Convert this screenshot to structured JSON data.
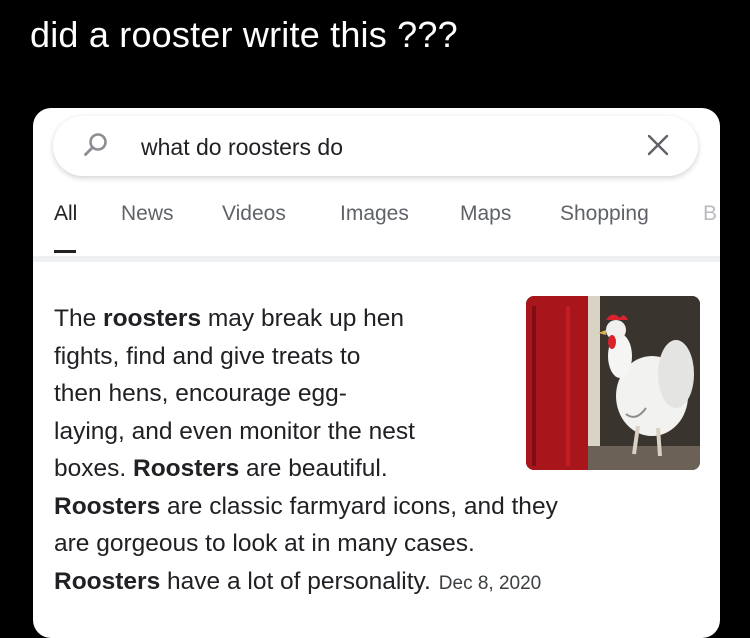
{
  "meme": {
    "caption": "did a rooster write this ???"
  },
  "search": {
    "query": "what do roosters do",
    "icons": {
      "search": "search-icon",
      "clear": "close-icon"
    }
  },
  "tabs": [
    {
      "label": "All",
      "active": true
    },
    {
      "label": "News",
      "active": false
    },
    {
      "label": "Videos",
      "active": false
    },
    {
      "label": "Images",
      "active": false
    },
    {
      "label": "Maps",
      "active": false
    },
    {
      "label": "Shopping",
      "active": false
    },
    {
      "label": "B",
      "active": false
    }
  ],
  "snippet": {
    "lines": [
      [
        {
          "text": "The "
        },
        {
          "text": "roosters",
          "bold": true
        },
        {
          "text": " may break up hen"
        }
      ],
      [
        {
          "text": "fights, find and give treats to"
        }
      ],
      [
        {
          "text": "then hens, encourage egg-"
        }
      ],
      [
        {
          "text": "laying, and even monitor the nest"
        }
      ],
      [
        {
          "text": "boxes. "
        },
        {
          "text": "Roosters",
          "bold": true
        },
        {
          "text": " are beautiful."
        }
      ],
      [
        {
          "text": "Roosters",
          "bold": true
        },
        {
          "text": " are classic farmyard icons, and they"
        }
      ],
      [
        {
          "text": "are gorgeous to look at in many cases."
        }
      ],
      [
        {
          "text": "Roosters",
          "bold": true
        },
        {
          "text": " have a lot of personality."
        }
      ]
    ],
    "date": "Dec 8, 2020",
    "thumbnail": "white rooster standing in a red barn doorway"
  },
  "colors": {
    "background": "#000000",
    "card": "#ffffff",
    "text": "#202124",
    "tab_inactive": "#5f6368",
    "barn_red": "#a8151b"
  }
}
